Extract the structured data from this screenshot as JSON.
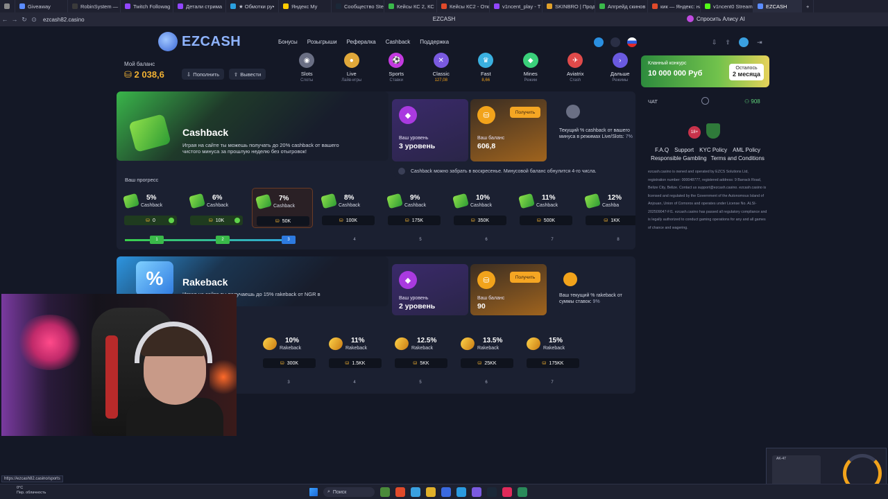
{
  "browser": {
    "tabs": [
      {
        "label": "",
        "color": "#888888"
      },
      {
        "label": "Giveaway",
        "color": "#5b8cff"
      },
      {
        "label": "RobinSystem —",
        "color": "#3a3a3a"
      },
      {
        "label": "Twitch Followag",
        "color": "#9146ff"
      },
      {
        "label": "Детали стрима",
        "color": "#9146ff"
      },
      {
        "label": "★ Обмотки ру•",
        "color": "#2aa0e0"
      },
      {
        "label": "Яндекс Му",
        "color": "#ffcc00"
      },
      {
        "label": "Сообщество Ste",
        "color": "#1b2838"
      },
      {
        "label": "Кейсы КС 2, КС",
        "color": "#3ab94a"
      },
      {
        "label": "Кейсы КС2 - Отк",
        "color": "#e04a2a"
      },
      {
        "label": "v1ncent_play - T",
        "color": "#9146ff"
      },
      {
        "label": "SKINBRO | Прод",
        "color": "#e0a02a"
      },
      {
        "label": "Апгрейд скинов",
        "color": "#3ab94a"
      },
      {
        "label": "кик — Яндекс: на",
        "color": "#e04a2a"
      },
      {
        "label": "v1ncent0 Stream",
        "color": "#53fc18"
      },
      {
        "label": "EZCASH",
        "color": "#5b8cff"
      }
    ],
    "url": "ezcash82.casino",
    "page_title": "EZCASH",
    "alice_label": "Спросить Алису AI",
    "status_url": "https://ezcash82.casino/sports"
  },
  "site": {
    "logo": "EZCASH",
    "nav": [
      "Бонусы",
      "Розыгрыши",
      "Рефералка",
      "Cashback",
      "Поддержка"
    ],
    "balance_label": "Мой баланс",
    "balance_value": "2 038,6",
    "deposit_label": "Пополнить",
    "withdraw_label": "Вывести",
    "categories": [
      {
        "name": "Slots",
        "sub": "Слоты",
        "color": "#6a6f84",
        "glyph": "◉",
        "sub_color": "#7e849c"
      },
      {
        "name": "Live",
        "sub": "Лайв-игры",
        "color": "#e0a83a",
        "glyph": "●",
        "sub_color": "#7e849c"
      },
      {
        "name": "Sports",
        "sub": "Ставки",
        "color": "#c43ae0",
        "glyph": "⚽",
        "sub_color": "#7e849c"
      },
      {
        "name": "Classic",
        "sub": "127,08",
        "color": "#7a5ae0",
        "glyph": "✕",
        "sub_color": "#f2a31b"
      },
      {
        "name": "Fast",
        "sub": "8,66",
        "color": "#3ab0e0",
        "glyph": "♛",
        "sub_color": "#f2a31b"
      },
      {
        "name": "Mines",
        "sub": "Режим",
        "color": "#3ad07a",
        "glyph": "◆",
        "sub_color": "#7e849c"
      },
      {
        "name": "Aviatrix",
        "sub": "Crash",
        "color": "#e04a4a",
        "glyph": "✈",
        "sub_color": "#7e849c"
      },
      {
        "name": "Дальше",
        "sub": "Режимы",
        "color": "#6a5ae0",
        "glyph": "›",
        "sub_color": "#7e849c"
      }
    ],
    "promo": {
      "line1": "Кланный конкурс",
      "line2": "10 000 000 Руб",
      "tag1": "Осталось",
      "tag2": "2 месяца"
    }
  },
  "chat": {
    "title": "ЧАТ",
    "online": "908",
    "age": "18+",
    "links_row1": [
      "F.A.Q",
      "Support",
      "KYC Policy",
      "AML Policy"
    ],
    "links_row2": [
      "Responsible Gambling",
      "Terms and Conditions"
    ],
    "legal": "ezcash.casino is owned and operated by EZCS Solutions Ltd, registration number: 000048777, registered address: 9 Barrack Road, Belize City, Belize. Contact us support@ezcash.casino. ezcash.casino is licensed and regulated by the Government of the Autonomous Island of Anjouan, Union of Comoros and operates under License No. ALSI-202509047-FI1. ezcash.casino has passed all regulatory compliance and is legally authorized to conduct gaming operations for any and all games of chance and wagering."
  },
  "cashback": {
    "title": "Cashback",
    "desc": "Играя на сайте ты можешь получать до 20% cashback от вашего чистого минуса за прошлую неделю без отыгровок!",
    "level_label": "Ваш уровень",
    "level_value": "3 уровень",
    "balance_label": "Ваш баланс",
    "balance_value": "606,8",
    "get_label": "Получить",
    "current_text": "Текущий % cashback от вашего минуса в режимах Live/Slots:",
    "current_value": "7%",
    "note": "Cashback можно забрать в воскресенье. Минусовой баланс обнулится 4-го числа.",
    "progress_label": "Ваш прогресс",
    "tiers": [
      {
        "pct": "5%",
        "name": "Cashback",
        "threshold": "0",
        "state": "done"
      },
      {
        "pct": "6%",
        "name": "Cashback",
        "threshold": "10K",
        "state": "done"
      },
      {
        "pct": "7%",
        "name": "Cashback",
        "threshold": "50K",
        "state": "active"
      },
      {
        "pct": "8%",
        "name": "Cashback",
        "threshold": "100K",
        "state": "future"
      },
      {
        "pct": "9%",
        "name": "Cashback",
        "threshold": "175K",
        "state": "future"
      },
      {
        "pct": "10%",
        "name": "Cashback",
        "threshold": "350K",
        "state": "future"
      },
      {
        "pct": "11%",
        "name": "Cashback",
        "threshold": "500K",
        "state": "future"
      },
      {
        "pct": "12%",
        "name": "Cashba",
        "threshold": "1KK",
        "state": "future"
      }
    ],
    "steps": [
      "1",
      "2",
      "3",
      "4",
      "5",
      "6",
      "7",
      "8"
    ],
    "steps_done": 3
  },
  "rakeback": {
    "title": "Rakeback",
    "desc": "Играя на сайте ты получаешь до 15% rakeback от NGR в",
    "level_label": "Ваш уровень",
    "level_value": "2 уровень",
    "balance_label": "Ваш баланс",
    "balance_value": "90",
    "get_label": "Получить",
    "current_text": "Ваш текущий % rakeback от суммы ставок:",
    "current_value": "9%",
    "tiers": [
      {
        "pct": "10%",
        "name": "Rakeback",
        "threshold": "300K"
      },
      {
        "pct": "11%",
        "name": "Rakeback",
        "threshold": "1.5KK"
      },
      {
        "pct": "12.5%",
        "name": "Rakeback",
        "threshold": "5KK"
      },
      {
        "pct": "13.5%",
        "name": "Rakeback",
        "threshold": "25KK"
      },
      {
        "pct": "15%",
        "name": "Rakeback",
        "threshold": "175KK"
      }
    ],
    "steps": [
      "3",
      "4",
      "5",
      "6",
      "7"
    ]
  },
  "pip": {
    "label": "AK-47"
  },
  "taskbar": {
    "search": "Поиск",
    "weather_temp": "0°C",
    "weather_desc": "Пер. облачность"
  }
}
